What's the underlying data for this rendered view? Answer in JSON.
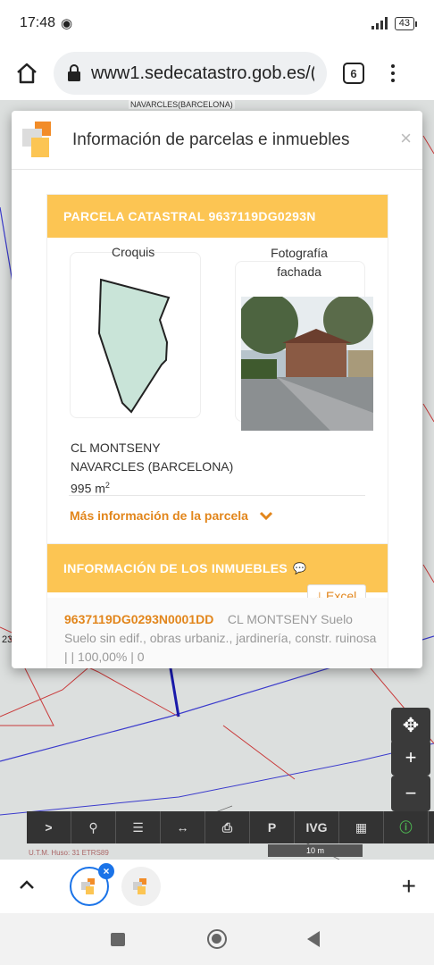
{
  "status_bar": {
    "time": "17:48",
    "battery": "43"
  },
  "browser": {
    "url": "www1.sedecatastro.gob.es/(",
    "tab_count": "6"
  },
  "map": {
    "top_label": "NAVARCLES(BARCELONA)",
    "parcel_number": "23",
    "scale": "10 m",
    "utm": "U.T.M. Huso: 31 ETRS89",
    "tools": [
      ">",
      "Q",
      "layers",
      "↔",
      "print",
      "P",
      "IVG",
      "blocks",
      "i"
    ]
  },
  "modal": {
    "title": "Información de parcelas e inmuebles",
    "parcel_header": "PARCELA CATASTRAL 9637119DG0293N",
    "croquis_label": "Croquis",
    "foto_label_1": "Fotografía",
    "foto_label_2": "fachada",
    "address_line1": "CL MONTSENY",
    "address_line2": "NAVARCLES (BARCELONA)",
    "area": "995 m",
    "area_sup": "2",
    "more_info": "Más información de la parcela",
    "inmuebles_header": "INFORMACIÓN DE LOS INMUEBLES",
    "excel_label": "Excel",
    "inmueble": {
      "ref": "9637119DG0293N0001DD",
      "address": "CL MONTSENY Suelo",
      "desc": "Suelo sin edif., obras urbaniz., jardinería, constr. ruinosa",
      "meta": " | | 100,00% | 0"
    }
  },
  "colors": {
    "accent_orange": "#fcc553",
    "link_orange": "#e2861c",
    "tab_blue": "#1a73e8"
  }
}
